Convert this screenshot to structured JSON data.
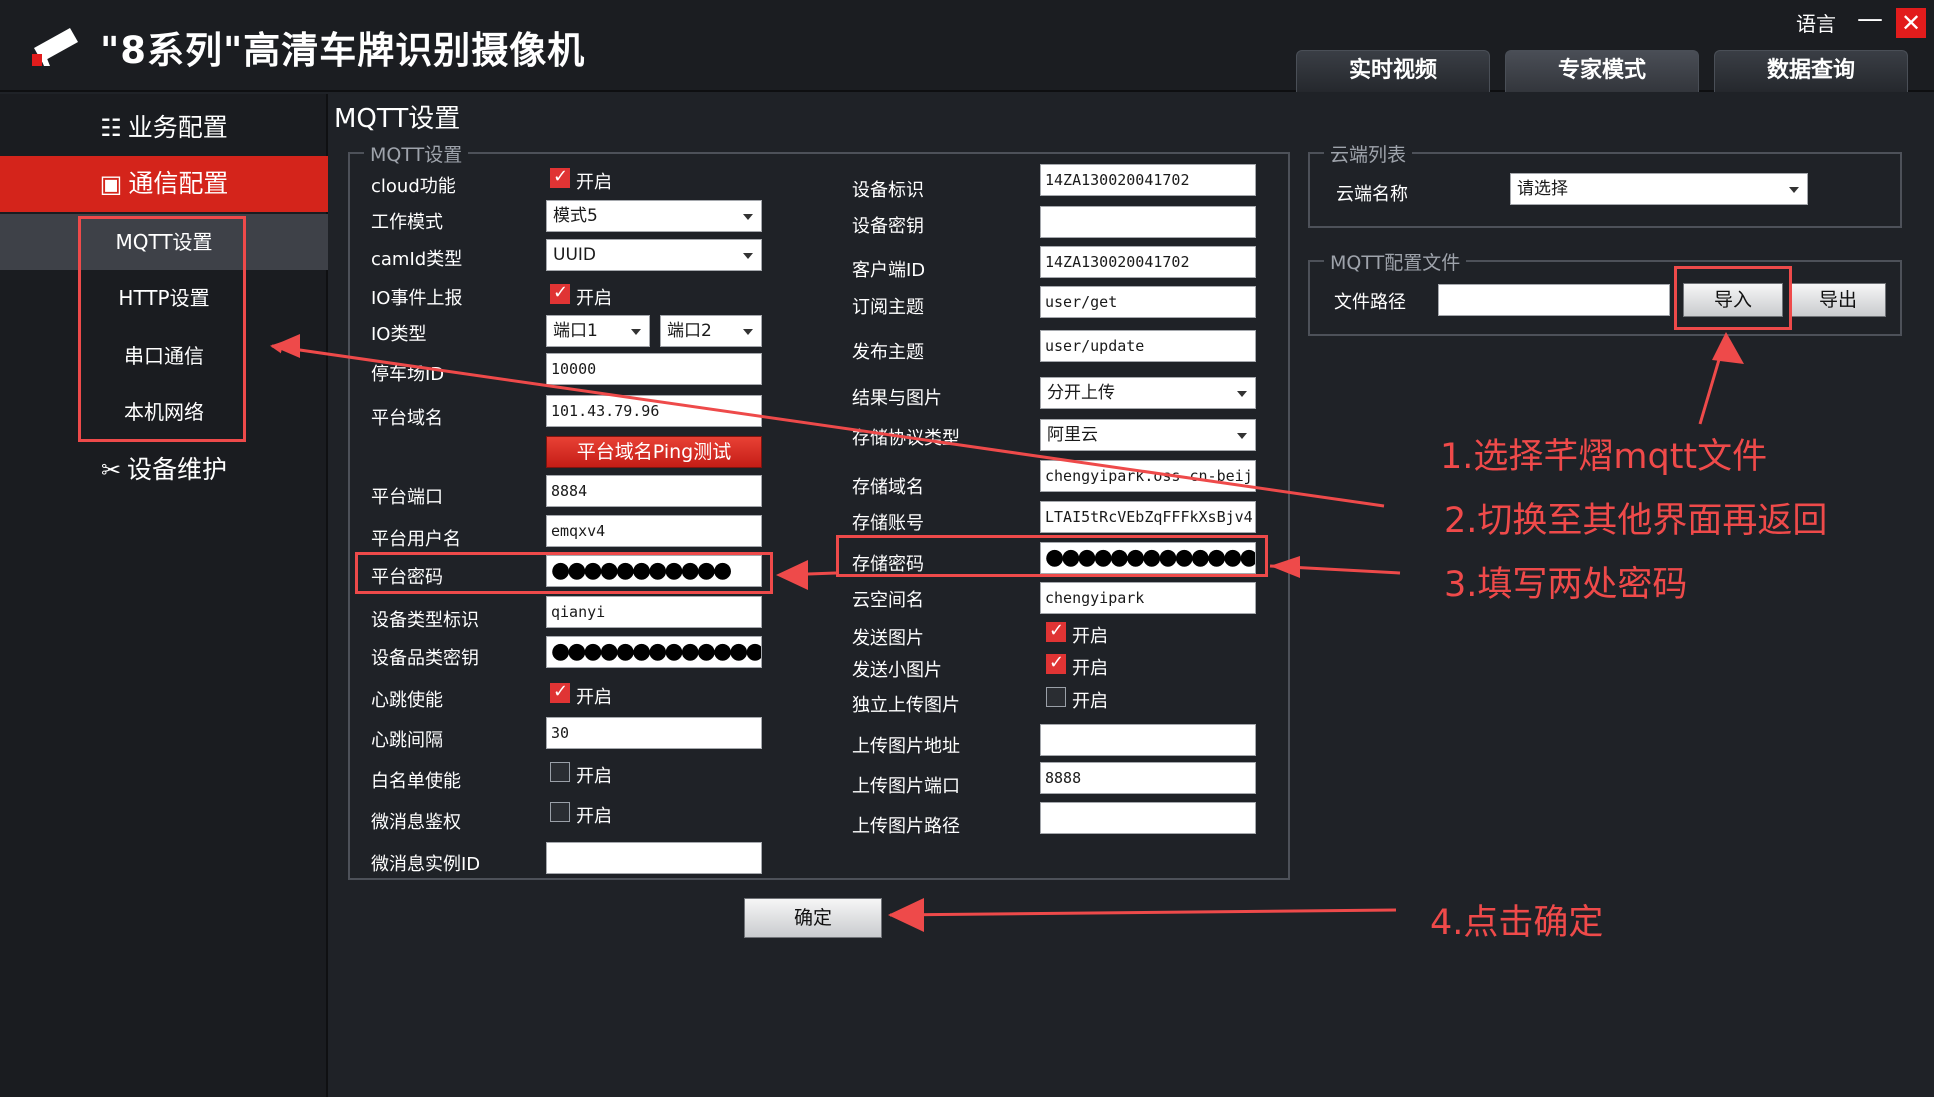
{
  "header": {
    "title": "\"8系列\"高清车牌识别摄像机",
    "language": "语言",
    "minimize": "—",
    "close": "✕",
    "tabs": [
      "实时视频",
      "专家模式",
      "数据查询"
    ],
    "active_tab": 1
  },
  "sidebar": {
    "business_config": "业务配置",
    "comm_config": "通信配置",
    "sub_items": [
      "MQTT设置",
      "HTTP设置",
      "串口通信",
      "本机网络"
    ],
    "device_maintenance": "设备维护"
  },
  "main": {
    "title": "MQTT设置",
    "mqtt_group_title": "MQTT设置",
    "left": {
      "cloud_label": "cloud功能",
      "cloud_checked": true,
      "work_mode_label": "工作模式",
      "work_mode_value": "模式5",
      "camid_label": "camId类型",
      "camid_value": "UUID",
      "io_report_label": "IO事件上报",
      "io_report_checked": true,
      "io_type_label": "IO类型",
      "io_port1": "端口1",
      "io_port2": "端口2",
      "parking_id_label": "停车场ID",
      "parking_id_value": "10000",
      "domain_label": "平台域名",
      "domain_value": "101.43.79.96",
      "ping_button": "平台域名Ping测试",
      "port_label": "平台端口",
      "port_value": "8884",
      "username_label": "平台用户名",
      "username_value": "emqxv4",
      "password_label": "平台密码",
      "password_value": "●●●●●●●●●●●",
      "device_type_label": "设备类型标识",
      "device_type_value": "qianyi",
      "product_key_label": "设备品类密钥",
      "product_key_value": "●●●●●●●●●●●●●",
      "heartbeat_enable_label": "心跳使能",
      "heartbeat_enable_checked": true,
      "heartbeat_interval_label": "心跳间隔",
      "heartbeat_interval_value": "30",
      "whitelist_label": "白名单使能",
      "whitelist_checked": false,
      "micro_auth_label": "微消息鉴权",
      "micro_auth_checked": false,
      "micro_instance_label": "微消息实例ID",
      "micro_instance_value": ""
    },
    "right": {
      "device_id_label": "设备标识",
      "device_id_value": "14ZA130020041702",
      "device_key_label": "设备密钥",
      "device_key_value": "",
      "client_id_label": "客户端ID",
      "client_id_value": "14ZA130020041702",
      "sub_topic_label": "订阅主题",
      "sub_topic_value": "user/get",
      "pub_topic_label": "发布主题",
      "pub_topic_value": "user/update",
      "result_image_label": "结果与图片",
      "result_image_value": "分开上传",
      "storage_protocol_label": "存储协议类型",
      "storage_protocol_value": "阿里云",
      "storage_domain_label": "存储域名",
      "storage_domain_value": "chengyipark.oss-cn-beij",
      "storage_account_label": "存储账号",
      "storage_account_value": "LTAI5tRcVEbZqFFFkXsBjv4",
      "storage_password_label": "存储密码",
      "storage_password_value": "●●●●●●●●●●●●●",
      "bucket_label": "云空间名",
      "bucket_value": "chengyipark",
      "send_image_label": "发送图片",
      "send_image_checked": true,
      "send_small_image_label": "发送小图片",
      "send_small_image_checked": true,
      "separate_upload_label": "独立上传图片",
      "separate_upload_checked": false,
      "upload_address_label": "上传图片地址",
      "upload_address_value": "",
      "upload_port_label": "上传图片端口",
      "upload_port_value": "8888",
      "upload_path_label": "上传图片路径",
      "upload_path_value": ""
    },
    "enable_text": "开启",
    "cloud_list": {
      "title": "云端列表",
      "name_label": "云端名称",
      "name_value": "请选择"
    },
    "config_file": {
      "title": "MQTT配置文件",
      "path_label": "文件路径",
      "path_value": "",
      "import": "导入",
      "export": "导出"
    },
    "confirm_button": "确定"
  },
  "annotations": {
    "step1": "1.选择芊熠mqtt文件",
    "step2": "2.切换至其他界面再返回",
    "step3": "3.填写两处密码",
    "step4": "4.点击确定"
  },
  "colors": {
    "accent_red": "#d4241b",
    "annotation_red": "#ef4a4a",
    "background": "#1f2227",
    "header_bg": "#1b1d21"
  }
}
